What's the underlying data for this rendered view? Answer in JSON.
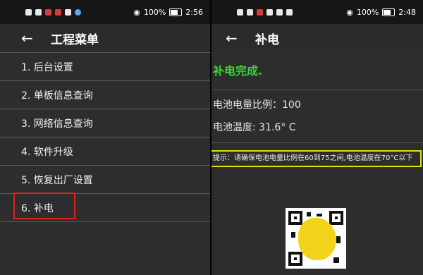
{
  "left": {
    "status": {
      "time": "2:56",
      "battery": "100%"
    },
    "app_bar": {
      "back_icon": "arrow-left-icon",
      "title": "工程菜单"
    },
    "menu_items": [
      "1. 后台设置",
      "2. 单板信息查询",
      "3. 网络信息查询",
      "4. 软件升级",
      "5. 恢复出厂设置",
      "6. 补电"
    ],
    "highlighted_item": "6. 补电"
  },
  "right": {
    "status": {
      "time": "2:48",
      "battery": "100%"
    },
    "app_bar": {
      "back_icon": "arrow-left-icon",
      "title": "补电"
    },
    "status_message": "补电完成.",
    "battery_ratio": "电池电量比例：100",
    "battery_temp": "电池温度: 31.6° C",
    "tip": "提示：请确保电池电量比例在60到75之间,电池温度在70°C以下"
  },
  "colors": {
    "accent_green": "#33d633",
    "highlight_red": "#e02020",
    "tip_border": "#e8e000",
    "background": "#2d2d2d"
  }
}
